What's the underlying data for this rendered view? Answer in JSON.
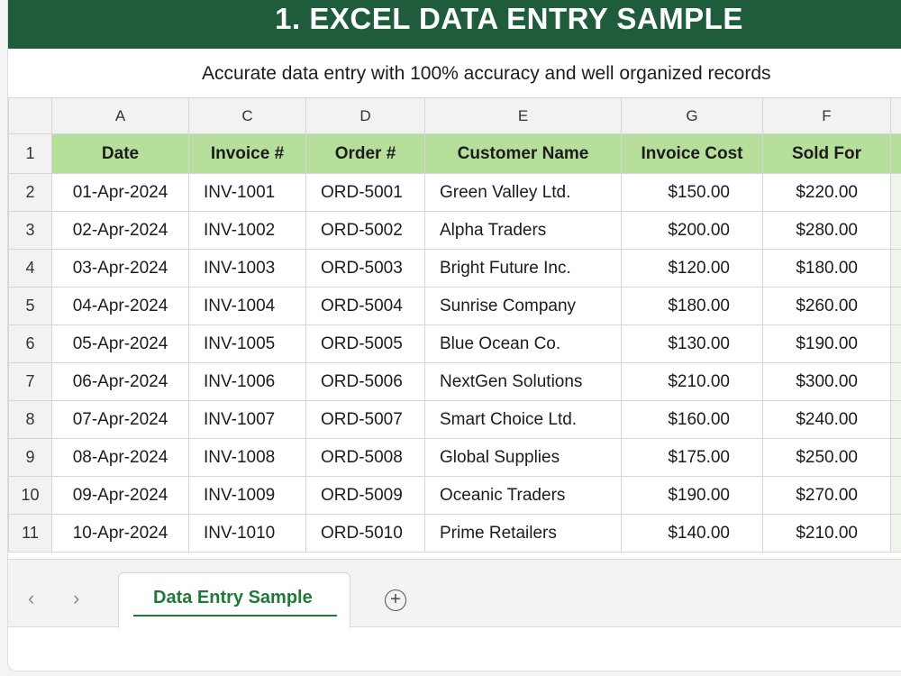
{
  "banner_title": "1. EXCEL DATA ENTRY SAMPLE",
  "subtitle": "Accurate data entry with 100% accuracy and well organized records",
  "column_letters": [
    "A",
    "C",
    "D",
    "E",
    "G",
    "F"
  ],
  "header_row_number": "1",
  "headers": [
    "Date",
    "Invoice #",
    "Order #",
    "Customer Name",
    "Invoice Cost",
    "Sold For"
  ],
  "rows": [
    {
      "n": "2",
      "date": "01-Apr-2024",
      "invoice": "INV-1001",
      "order": "ORD-5001",
      "customer": "Green Valley Ltd.",
      "cost": "$150.00",
      "sold": "$220.00"
    },
    {
      "n": "3",
      "date": "02-Apr-2024",
      "invoice": "INV-1002",
      "order": "ORD-5002",
      "customer": "Alpha Traders",
      "cost": "$200.00",
      "sold": "$280.00"
    },
    {
      "n": "4",
      "date": "03-Apr-2024",
      "invoice": "INV-1003",
      "order": "ORD-5003",
      "customer": "Bright Future Inc.",
      "cost": "$120.00",
      "sold": "$180.00"
    },
    {
      "n": "5",
      "date": "04-Apr-2024",
      "invoice": "INV-1004",
      "order": "ORD-5004",
      "customer": "Sunrise Company",
      "cost": "$180.00",
      "sold": "$260.00"
    },
    {
      "n": "6",
      "date": "05-Apr-2024",
      "invoice": "INV-1005",
      "order": "ORD-5005",
      "customer": "Blue Ocean Co.",
      "cost": "$130.00",
      "sold": "$190.00"
    },
    {
      "n": "7",
      "date": "06-Apr-2024",
      "invoice": "INV-1006",
      "order": "ORD-5006",
      "customer": "NextGen Solutions",
      "cost": "$210.00",
      "sold": "$300.00"
    },
    {
      "n": "8",
      "date": "07-Apr-2024",
      "invoice": "INV-1007",
      "order": "ORD-5007",
      "customer": "Smart Choice Ltd.",
      "cost": "$160.00",
      "sold": "$240.00"
    },
    {
      "n": "9",
      "date": "08-Apr-2024",
      "invoice": "INV-1008",
      "order": "ORD-5008",
      "customer": "Global Supplies",
      "cost": "$175.00",
      "sold": "$250.00"
    },
    {
      "n": "10",
      "date": "09-Apr-2024",
      "invoice": "INV-1009",
      "order": "ORD-5009",
      "customer": "Oceanic Traders",
      "cost": "$190.00",
      "sold": "$270.00"
    },
    {
      "n": "11",
      "date": "10-Apr-2024",
      "invoice": "INV-1010",
      "order": "ORD-5010",
      "customer": "Prime Retailers",
      "cost": "$140.00",
      "sold": "$210.00"
    }
  ],
  "tabs": {
    "prev_icon": "chevron-left-icon",
    "next_icon": "chevron-right-icon",
    "active_sheet": "Data Entry Sample",
    "add_icon": "plus-circle-icon"
  },
  "colors": {
    "banner": "#1f5c3c",
    "header_fill": "#b7df9c",
    "active_tab_text": "#1f7a3a"
  }
}
